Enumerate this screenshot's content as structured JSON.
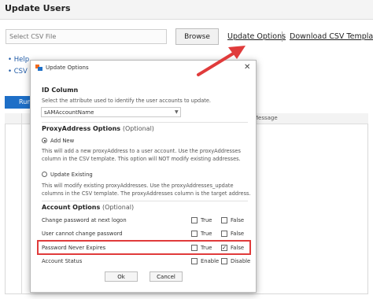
{
  "page": {
    "title": "Update Users",
    "csv_placeholder": "Select CSV File",
    "browse_label": "Browse",
    "update_options_link": "Update Options",
    "download_link": "Download CSV Template",
    "help_link": "Help",
    "csv_link": "CSV H",
    "run_label": "Run",
    "message_header": "Message"
  },
  "dialog": {
    "title": "Update Options",
    "close_glyph": "✕",
    "id_column": {
      "heading": "ID Column",
      "description": "Select the attribute used to identify the user accounts to update.",
      "selected": "sAMAccountName"
    },
    "proxy": {
      "heading": "ProxyAddress Options",
      "optional": "(Optional)",
      "add_new": {
        "label": "Add New",
        "checked": true,
        "line1": "This will add a new proxyAddress to a user account. Use the proxyAddresses",
        "line2": "column in the CSV template. This option will NOT modify existing addresses."
      },
      "update_existing": {
        "label": "Update Existing",
        "checked": false,
        "line1": "This will modify existing proxyAddresses. Use the proxyAddresses_update",
        "line2": "columns in the CSV template. The proxyAddresses column is the target address."
      }
    },
    "account": {
      "heading": "Account Options",
      "optional": "(Optional)",
      "rows": [
        {
          "label": "Change password at next logon",
          "a": "True",
          "a_checked": false,
          "b": "False",
          "b_checked": false
        },
        {
          "label": "User cannot change password",
          "a": "True",
          "a_checked": false,
          "b": "False",
          "b_checked": false
        },
        {
          "label": "Password Never Expires",
          "a": "True",
          "a_checked": false,
          "b": "False",
          "b_checked": true
        },
        {
          "label": "Account Status",
          "a": "Enable",
          "a_checked": false,
          "b": "Disable",
          "b_checked": false
        }
      ]
    },
    "ok_label": "Ok",
    "cancel_label": "Cancel"
  },
  "colors": {
    "accent": "#1e6fc7",
    "highlight": "#e03b3b",
    "arrow": "#e03b3b",
    "app_icon_orange": "#f26b1d",
    "app_icon_blue": "#1e6fc7"
  },
  "icons": {
    "dialog_icon": "app-logo-icon",
    "close": "close-icon",
    "dropdown": "chevron-down-icon",
    "annotation": "red-arrow-annotation"
  }
}
